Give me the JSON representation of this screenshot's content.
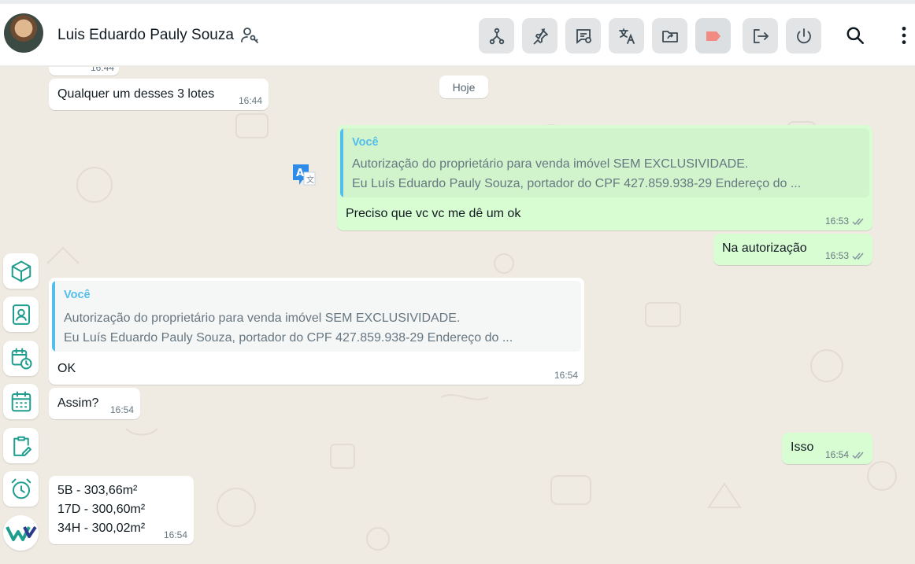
{
  "header": {
    "contact_name": "Luis Eduardo Pauly Souza"
  },
  "toolbar": {
    "icons": [
      "branch-icon",
      "pin-icon",
      "message-settings-icon",
      "translate-icon",
      "forward-folder-icon",
      "label-icon",
      "logout-icon",
      "power-icon",
      "search-icon",
      "more-vert-icon"
    ],
    "label_color": "#f28b82"
  },
  "chat": {
    "date_chip": "Hoje",
    "messages": [
      {
        "time": "16:44"
      },
      {
        "text": "Qualquer um desses 3 lotes",
        "time": "16:44"
      },
      {
        "quote_author": "Você",
        "quote_line1": "Autorização do proprietário para venda imóvel SEM EXCLUSIVIDADE.",
        "quote_line2": "Eu Luís Eduardo Pauly Souza, portador do CPF 427.859.938-29 Endereço do ...",
        "text": "Preciso que vc vc me dê um ok",
        "time": "16:53"
      },
      {
        "text": "Na autorização",
        "time": "16:53"
      },
      {
        "quote_author": "Você",
        "quote_line1": "Autorização do proprietário para venda imóvel SEM EXCLUSIVIDADE.",
        "quote_line2": "Eu Luís Eduardo Pauly Souza, portador do CPF 427.859.938-29 Endereço do ...",
        "text": "OK",
        "time": "16:54"
      },
      {
        "text": "Assim?",
        "time": "16:54"
      },
      {
        "text": "Isso",
        "time": "16:54"
      },
      {
        "line1": "5B - 303,66m²",
        "line2": "17D - 300,60m²",
        "line3": "34H - 300,02m²",
        "time": "16:54"
      }
    ]
  },
  "sidebar": {
    "icons": [
      "cube-icon",
      "contact-card-icon",
      "calendar-clock-icon",
      "calendar-icon",
      "clipboard-edit-icon",
      "alarm-clock-icon",
      "app-logo-icon"
    ]
  },
  "colors": {
    "accent": "#1f9e8f",
    "outgoing": "#d9fdd3",
    "quote_accent": "#53bdeb",
    "background": "#efeae2"
  }
}
